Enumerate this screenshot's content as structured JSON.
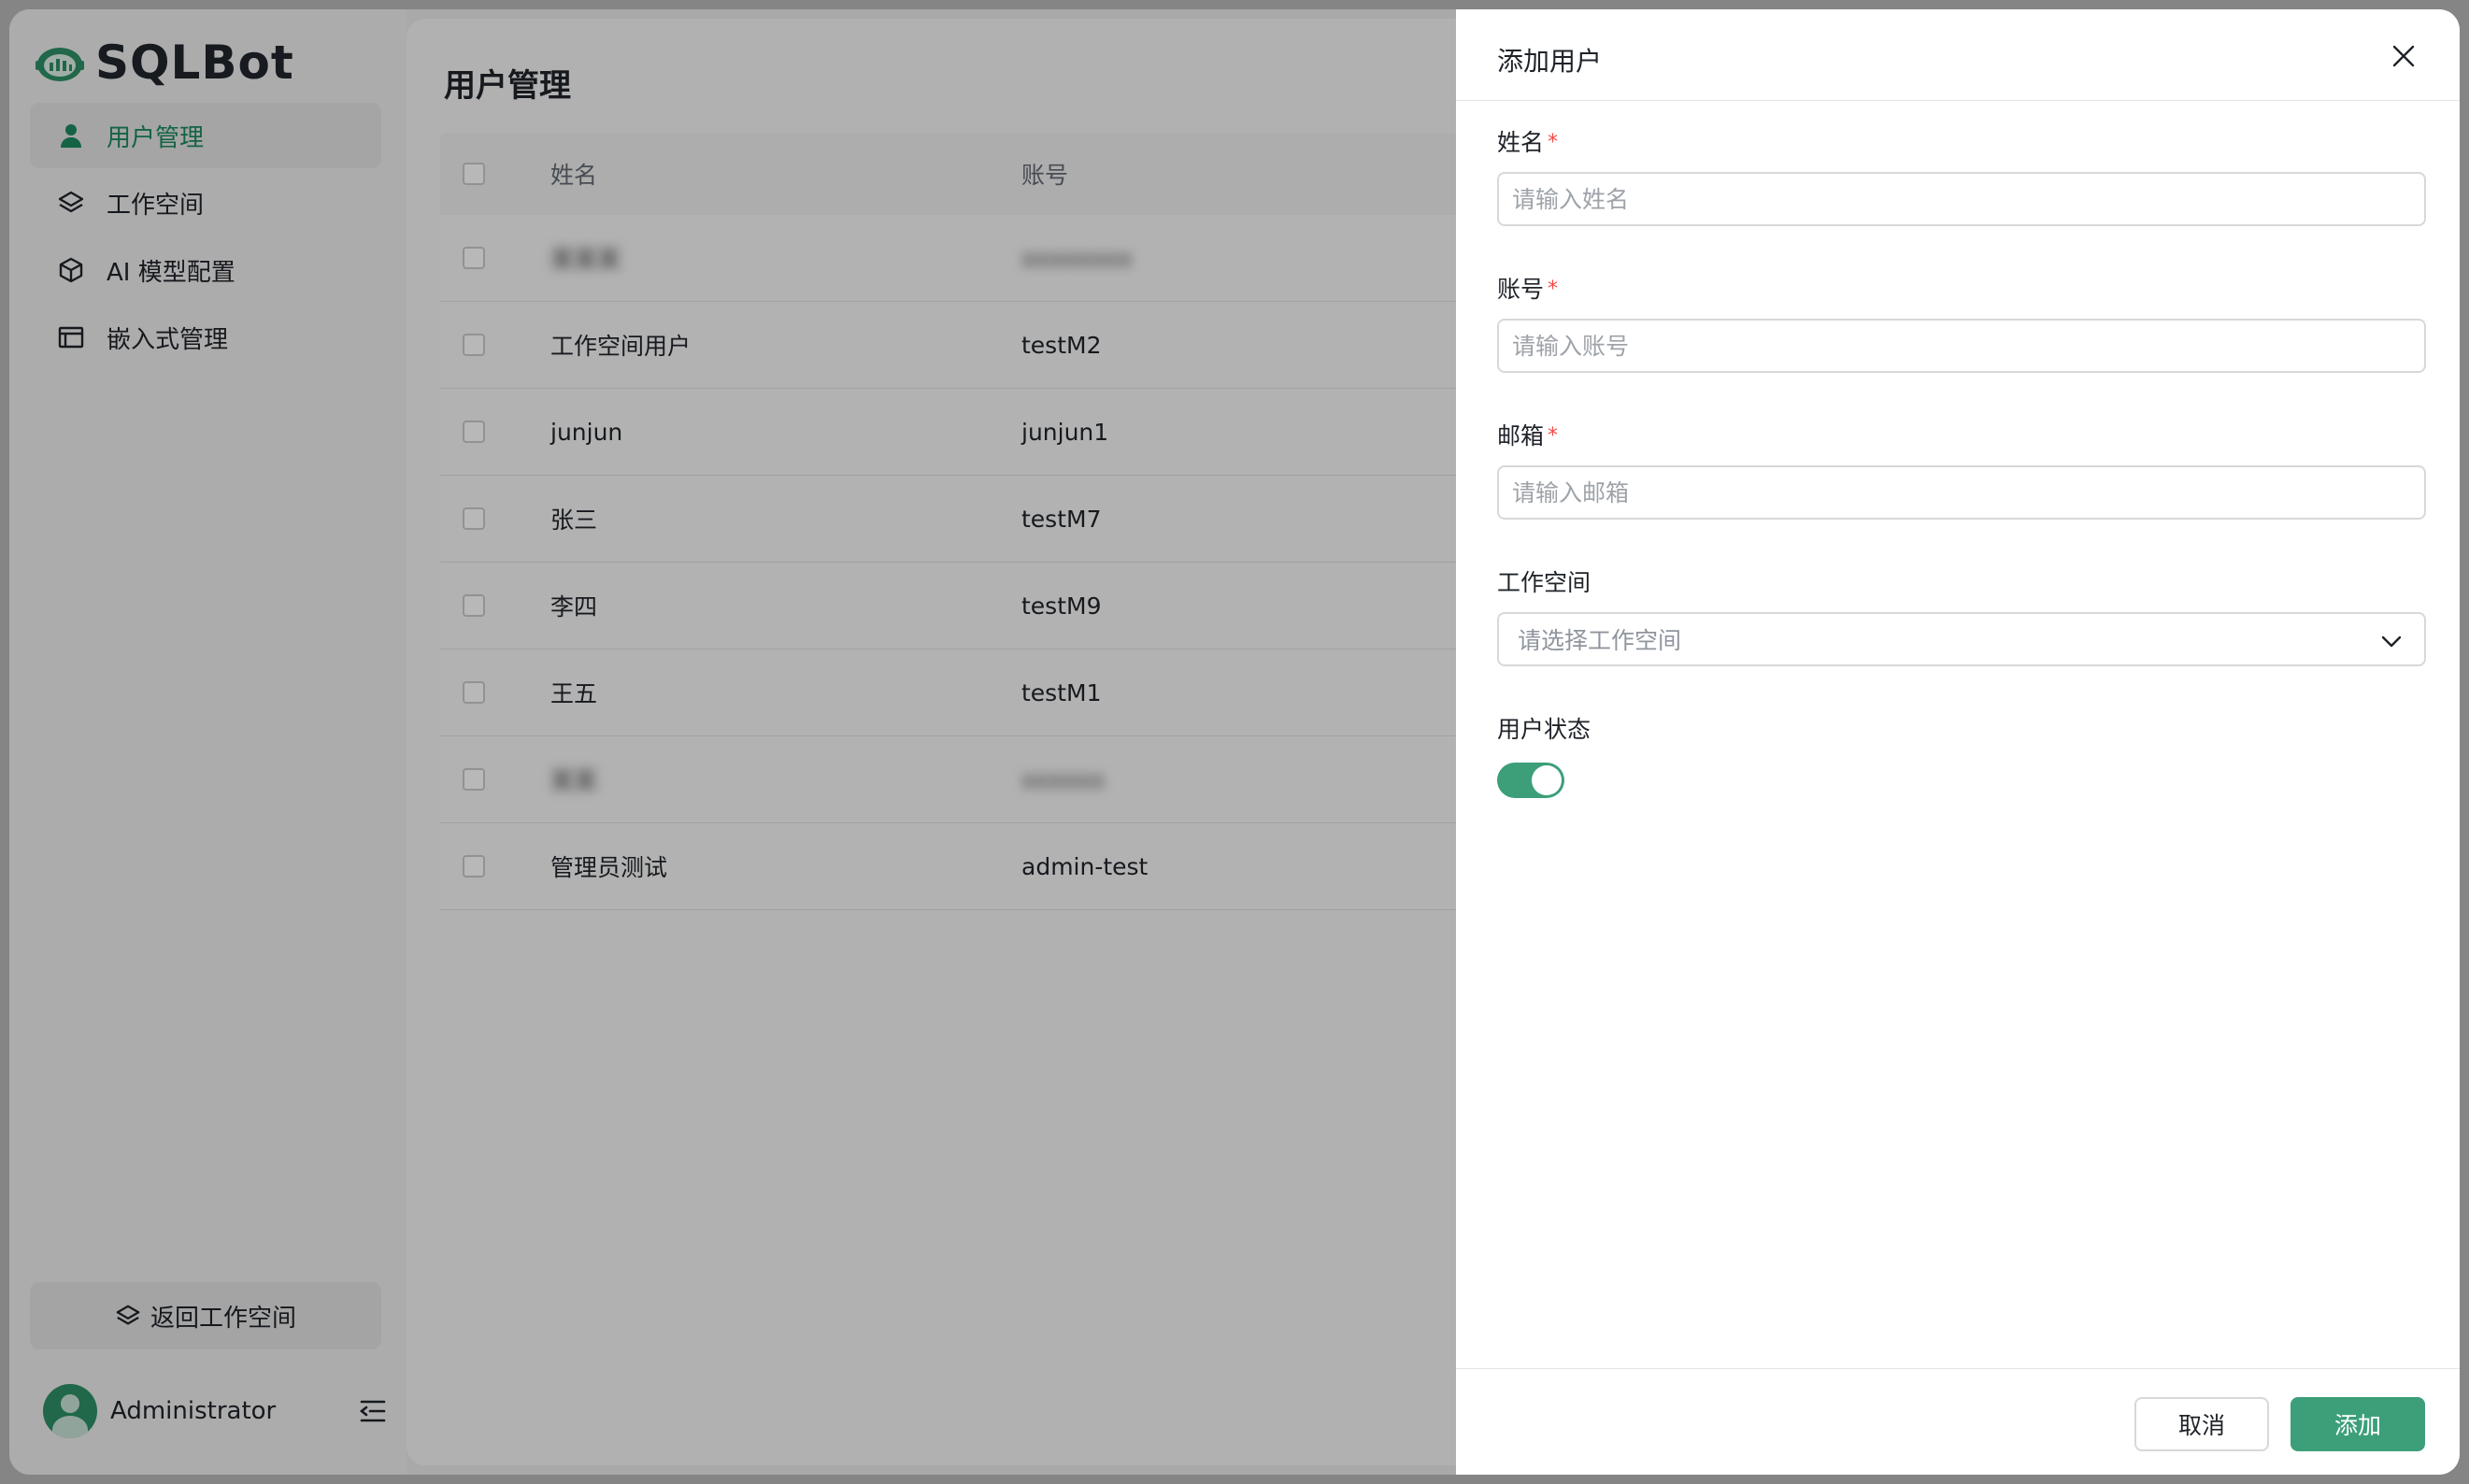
{
  "app": {
    "name": "SQLBot"
  },
  "sidebar": {
    "items": [
      {
        "label": "用户管理",
        "icon": "user-icon",
        "active": true
      },
      {
        "label": "工作空间",
        "icon": "layers-icon",
        "active": false
      },
      {
        "label": "AI 模型配置",
        "icon": "cube-icon",
        "active": false
      },
      {
        "label": "嵌入式管理",
        "icon": "embed-window-icon",
        "active": false
      }
    ],
    "back_label": "返回工作空间",
    "user_name": "Administrator"
  },
  "main": {
    "title": "用户管理",
    "columns": [
      "姓名",
      "账号"
    ],
    "rows": [
      {
        "name": "某某某",
        "account": "xxxxxxxx",
        "blurred": true
      },
      {
        "name": "工作空间用户",
        "account": "testM2",
        "blurred": false
      },
      {
        "name": "junjun",
        "account": "junjun1",
        "blurred": false
      },
      {
        "name": "张三",
        "account": "testM7",
        "blurred": false
      },
      {
        "name": "李四",
        "account": "testM9",
        "blurred": false
      },
      {
        "name": "王五",
        "account": "testM1",
        "blurred": false
      },
      {
        "name": "某某",
        "account": "xxxxxx",
        "blurred": true
      },
      {
        "name": "管理员测试",
        "account": "admin-test",
        "blurred": false
      }
    ]
  },
  "drawer": {
    "title": "添加用户",
    "fields": {
      "name": {
        "label": "姓名",
        "placeholder": "请输入姓名",
        "required": "*"
      },
      "account": {
        "label": "账号",
        "placeholder": "请输入账号",
        "required": "*"
      },
      "email": {
        "label": "邮箱",
        "placeholder": "请输入邮箱",
        "required": "*"
      },
      "workspace": {
        "label": "工作空间",
        "placeholder": "请选择工作空间"
      },
      "status": {
        "label": "用户状态",
        "enabled": true
      }
    },
    "cancel_label": "取消",
    "submit_label": "添加"
  },
  "colors": {
    "accent": "#3c9f79",
    "active_text": "#1c8a5f",
    "required": "#f54a45"
  }
}
